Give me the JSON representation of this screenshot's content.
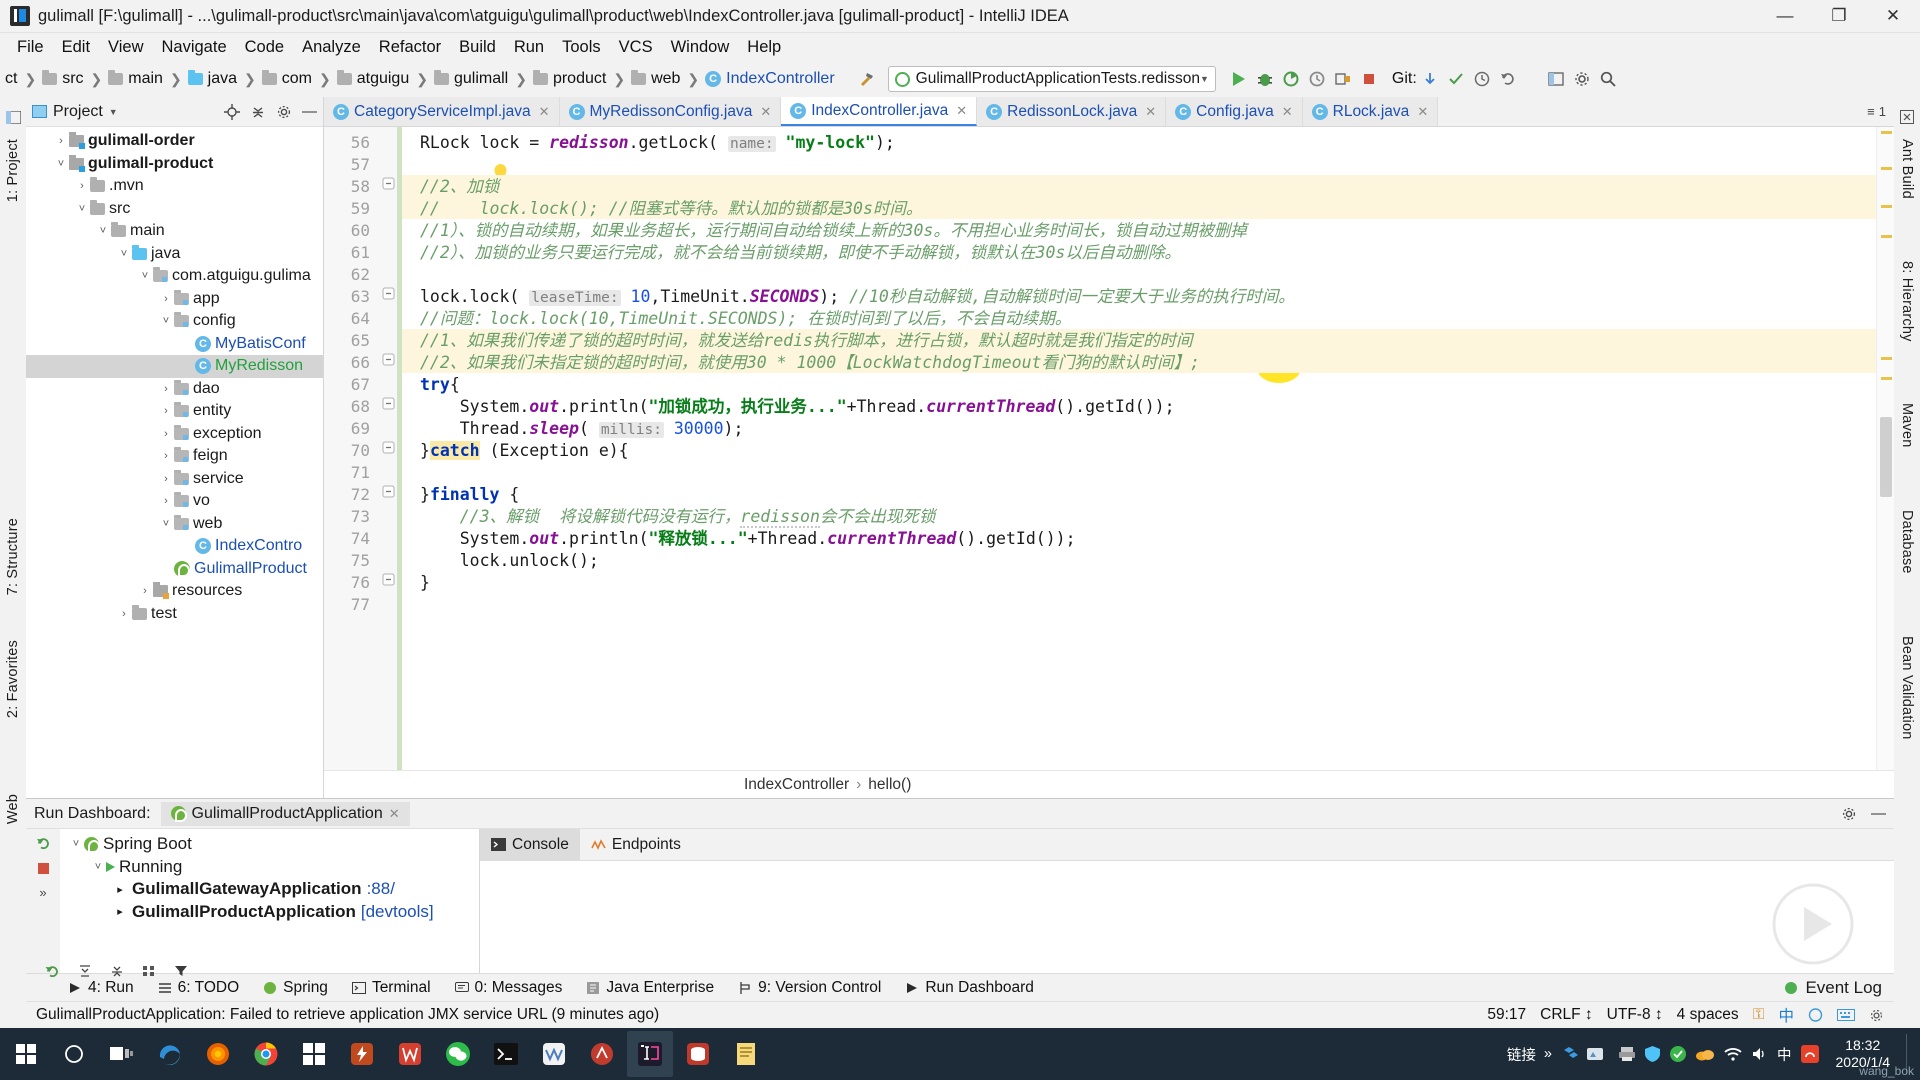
{
  "window": {
    "title": "gulimall [F:\\gulimall] - ...\\gulimall-product\\src\\main\\java\\com\\atguigu\\gulimall\\product\\web\\IndexController.java [gulimall-product] - IntelliJ IDEA",
    "minimize": "—",
    "maximize": "❐",
    "close": "✕"
  },
  "menu": [
    "File",
    "Edit",
    "View",
    "Navigate",
    "Code",
    "Analyze",
    "Refactor",
    "Build",
    "Run",
    "Tools",
    "VCS",
    "Window",
    "Help"
  ],
  "navbar": {
    "crumbs": [
      "ct",
      "src",
      "main",
      "java",
      "com",
      "atguigu",
      "gulimall",
      "product",
      "web",
      "IndexController"
    ],
    "run_config": "GulimallProductApplicationTests.redisson",
    "git_label": "Git:"
  },
  "project_panel": {
    "title": "Project",
    "tree": [
      {
        "label": "gulimall-order",
        "depth": 1,
        "arrow": "›",
        "icon": "module",
        "bold": true
      },
      {
        "label": "gulimall-product",
        "depth": 1,
        "arrow": "˅",
        "icon": "module",
        "bold": true
      },
      {
        "label": ".mvn",
        "depth": 2,
        "arrow": "›",
        "icon": "folder-gray"
      },
      {
        "label": "src",
        "depth": 2,
        "arrow": "˅",
        "icon": "folder-gray"
      },
      {
        "label": "main",
        "depth": 3,
        "arrow": "˅",
        "icon": "folder-gray"
      },
      {
        "label": "java",
        "depth": 4,
        "arrow": "˅",
        "icon": "folder-blue"
      },
      {
        "label": "com.atguigu.gulima",
        "depth": 5,
        "arrow": "˅",
        "icon": "package"
      },
      {
        "label": "app",
        "depth": 6,
        "arrow": "›",
        "icon": "package"
      },
      {
        "label": "config",
        "depth": 6,
        "arrow": "˅",
        "icon": "package"
      },
      {
        "label": "MyBatisConf",
        "depth": 7,
        "arrow": "",
        "icon": "class",
        "color": "blue"
      },
      {
        "label": "MyRedisson",
        "depth": 7,
        "arrow": "",
        "icon": "class",
        "color": "green",
        "selected": true
      },
      {
        "label": "dao",
        "depth": 6,
        "arrow": "›",
        "icon": "package"
      },
      {
        "label": "entity",
        "depth": 6,
        "arrow": "›",
        "icon": "package"
      },
      {
        "label": "exception",
        "depth": 6,
        "arrow": "›",
        "icon": "package"
      },
      {
        "label": "feign",
        "depth": 6,
        "arrow": "›",
        "icon": "package"
      },
      {
        "label": "service",
        "depth": 6,
        "arrow": "›",
        "icon": "package"
      },
      {
        "label": "vo",
        "depth": 6,
        "arrow": "›",
        "icon": "package"
      },
      {
        "label": "web",
        "depth": 6,
        "arrow": "˅",
        "icon": "package"
      },
      {
        "label": "IndexContro",
        "depth": 7,
        "arrow": "",
        "icon": "class",
        "color": "blue"
      },
      {
        "label": "GulimallProduct",
        "depth": 6,
        "arrow": "",
        "icon": "spring",
        "color": "blue"
      },
      {
        "label": "resources",
        "depth": 5,
        "arrow": "›",
        "icon": "resources"
      },
      {
        "label": "test",
        "depth": 4,
        "arrow": "›",
        "icon": "folder-gray"
      }
    ]
  },
  "editor": {
    "tabs": [
      {
        "label": "CategoryServiceImpl.java",
        "active": false
      },
      {
        "label": "MyRedissonConfig.java",
        "active": false
      },
      {
        "label": "IndexController.java",
        "active": true
      },
      {
        "label": "RedissonLock.java",
        "active": false
      },
      {
        "label": "Config.java",
        "active": false
      },
      {
        "label": "RLock.java",
        "active": false
      }
    ],
    "tab_overflow": "1",
    "first_line_number": 56,
    "line_numbers": [
      56,
      57,
      58,
      59,
      60,
      61,
      62,
      63,
      64,
      65,
      66,
      67,
      68,
      69,
      70,
      71,
      72,
      73,
      74,
      75,
      76,
      77
    ],
    "lines": [
      "RLock lock = redisson.getLock( name: \"my-lock\");",
      "",
      "//2、加锁",
      "//    lock.lock(); //阻塞式等待。默认加的锁都是30s时间。",
      "//1）、锁的自动续期，如果业务超长，运行期间自动给锁续上新的30s。不用担心业务时间长，锁自动过期被删掉",
      "//2）、加锁的业务只要运行完成，就不会给当前锁续期，即使不手动解锁，锁默认在30s以后自动删除。",
      "",
      "lock.lock( leaseTime: 10,TimeUnit.SECONDS); //10秒自动解锁,自动解锁时间一定要大于业务的执行时间。",
      "//问题：lock.lock(10,TimeUnit.SECONDS); 在锁时间到了以后，不会自动续期。",
      "//1、如果我们传递了锁的超时时间，就发送给redis执行脚本，进行占锁，默认超时就是我们指定的时间",
      "//2、如果我们未指定锁的超时时间，就使用30 * 1000【LockWatchdogTimeout看门狗的默认时间】;",
      "try{",
      "    System.out.println(\"加锁成功，执行业务...\"+Thread.currentThread().getId());",
      "    Thread.sleep( millis: 30000);",
      "}catch (Exception e){",
      "",
      "}finally {",
      "    //3、解锁  将设解锁代码没有运行，redisson会不会出现死锁",
      "    System.out.println(\"释放锁...\"+Thread.currentThread().getId());",
      "    lock.unlock();",
      "}",
      ""
    ],
    "breadcrumb": [
      "IndexController",
      "hello()"
    ]
  },
  "run_dashboard": {
    "title": "Run Dashboard:",
    "tab": "GulimallProductApplication",
    "tree": [
      {
        "label": "Spring Boot",
        "depth": 0,
        "arrow": "˅",
        "icon": "spring"
      },
      {
        "label": "Running",
        "depth": 1,
        "arrow": "˅",
        "icon": "run"
      },
      {
        "label": "GulimallGatewayApplication",
        "suffix": ":88/",
        "depth": 2,
        "arrow": "▸",
        "icon": "none",
        "bold": true
      },
      {
        "label": "GulimallProductApplication",
        "suffix": "[devtools]",
        "depth": 2,
        "arrow": "▸",
        "icon": "none",
        "bold": true
      }
    ],
    "console_tabs": [
      {
        "label": "Console",
        "active": true
      },
      {
        "label": "Endpoints",
        "active": false
      }
    ]
  },
  "toolwindow_bar": {
    "items": [
      {
        "label": "4: Run",
        "icon": "run-icon"
      },
      {
        "label": "6: TODO",
        "icon": "list-icon"
      },
      {
        "label": "Spring",
        "icon": "spring-icon"
      },
      {
        "label": "Terminal",
        "icon": "terminal-icon"
      },
      {
        "label": "0: Messages",
        "icon": "message-icon"
      },
      {
        "label": "Java Enterprise",
        "icon": "java-icon"
      },
      {
        "label": "9: Version Control",
        "icon": "vcs-icon"
      },
      {
        "label": "Run Dashboard",
        "icon": "dashboard-icon"
      }
    ],
    "event_log": "Event Log"
  },
  "left_rail": [
    "1: Project",
    "7: Structure",
    "2: Favorites",
    "Web"
  ],
  "right_rail": [
    "Ant Build",
    "8: Hierarchy",
    "Maven",
    "Database",
    "Bean Validation"
  ],
  "status_bar": {
    "message": "GulimallProductApplication: Failed to retrieve application JMX service URL (9 minutes ago)",
    "position": "59:17",
    "line_sep": "CRLF ↕",
    "encoding": "UTF-8 ↕",
    "indent": "4 spaces",
    "lock": "⚿",
    "ime": "中"
  },
  "taskbar": {
    "link_label": "链接",
    "chevron": "»",
    "ime": "中",
    "clock_time": "18:32",
    "clock_date": "2020/1/4",
    "user_watermark": "wang_bok"
  },
  "colors": {
    "accent_blue": "#1c4fb3",
    "keyword_blue": "#0033b3",
    "string_green": "#067d17",
    "comment_gray": "#8c8c8c",
    "comment_green": "#6a9e69",
    "field_purple": "#871094",
    "number_blue": "#1750eb",
    "highlight_yellow": "#fdf6dd",
    "taskbar_bg": "#1d2b38"
  }
}
